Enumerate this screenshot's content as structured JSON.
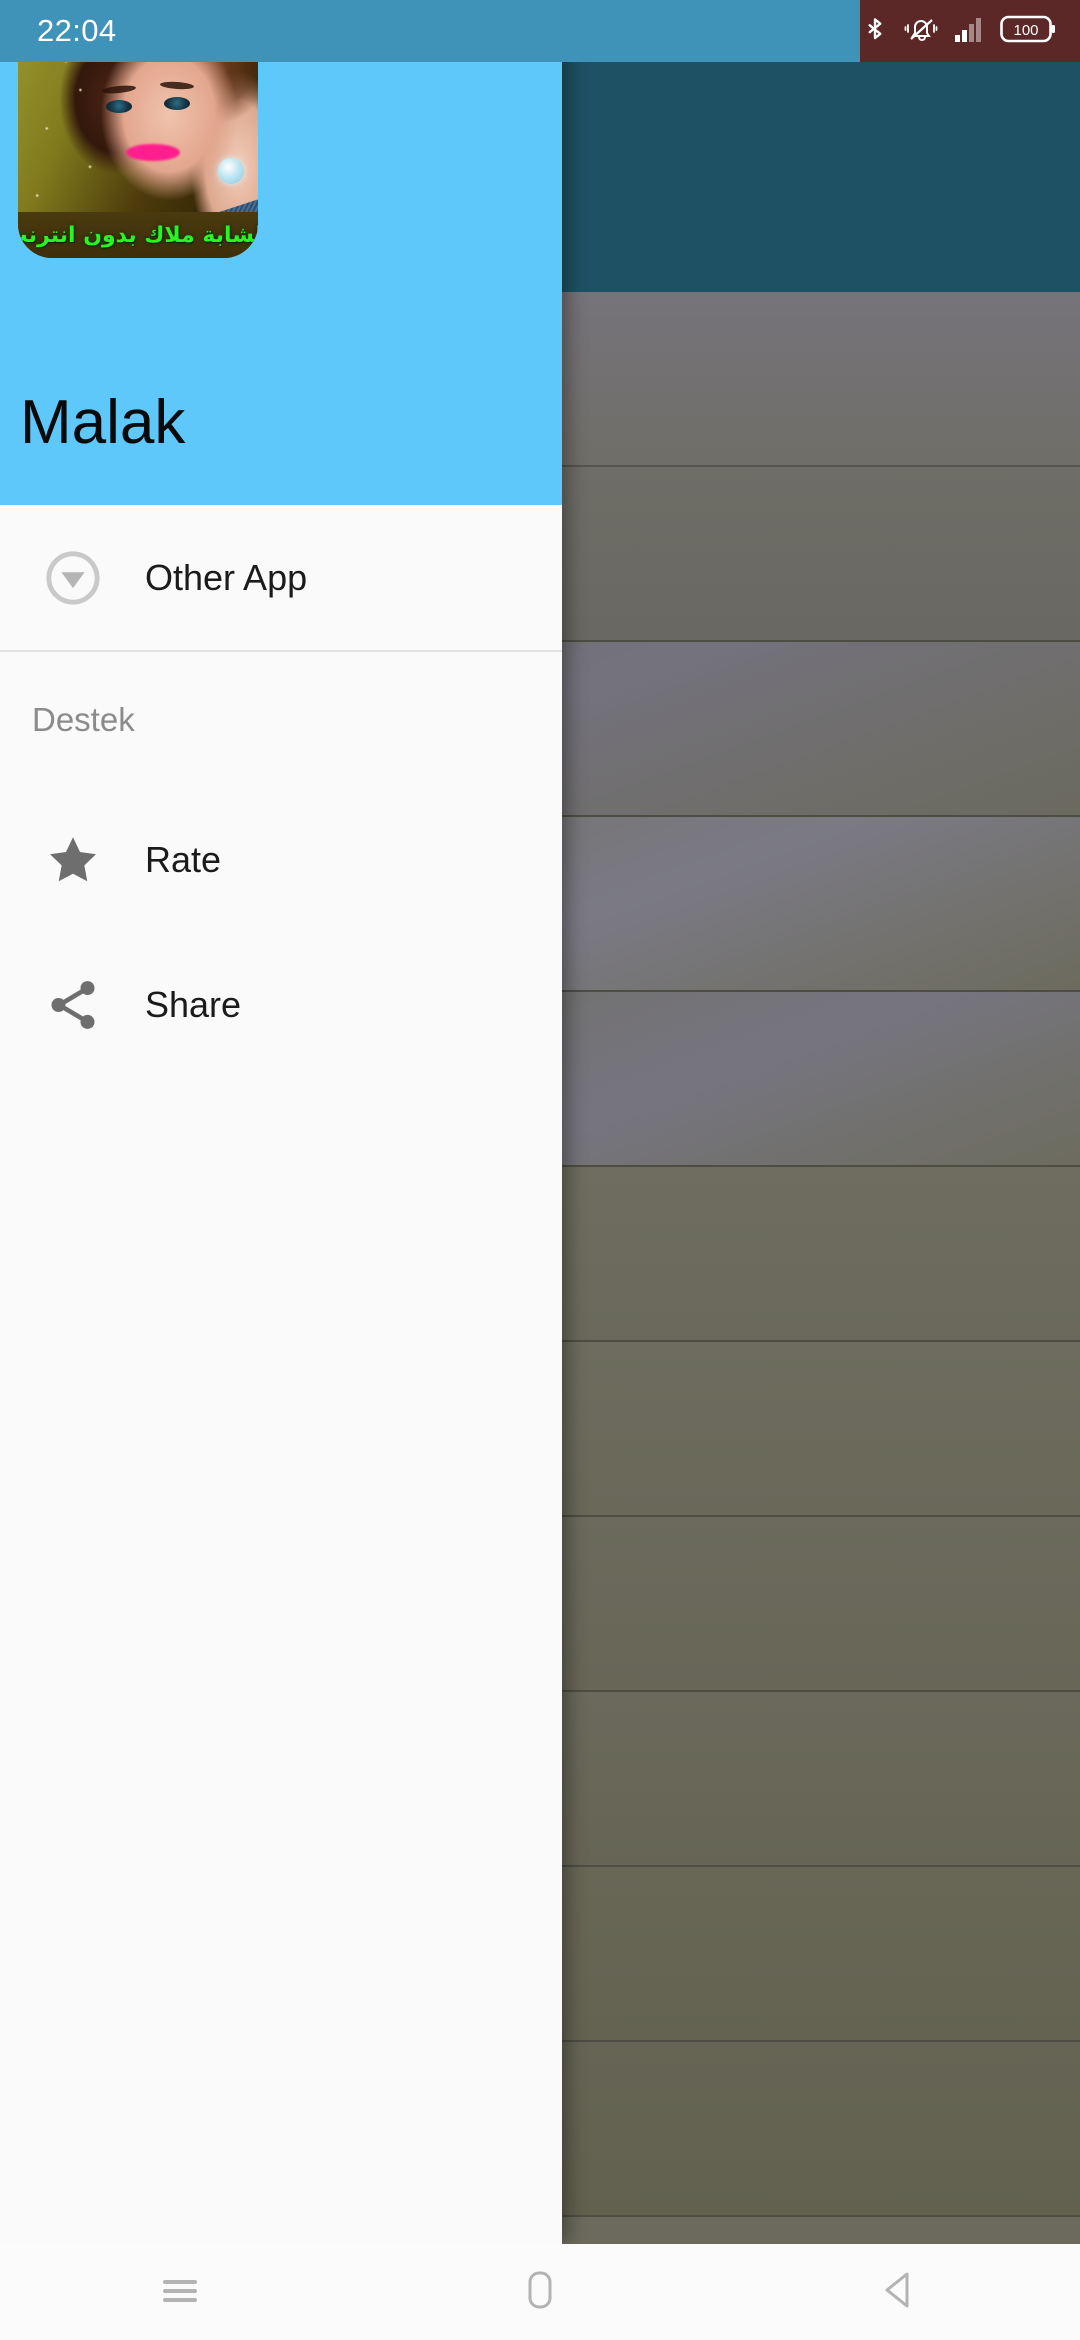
{
  "status_bar": {
    "clock": "22:04",
    "battery_level": "100",
    "icons": [
      "bluetooth-icon",
      "vibrate-mute-icon",
      "signal-bars-icon",
      "battery-icon"
    ],
    "left_background_color": "#3f92b8",
    "right_background_color": "#5c2727"
  },
  "drawer": {
    "header": {
      "app_name": "Malak",
      "icon_caption": "الشابة ملاك بدون انترنت",
      "background_color": "#5ec8fa",
      "title_color": "#0a0a0a",
      "caption_color": "#29f522"
    },
    "items": [
      {
        "id": "other-app",
        "label": "Other App",
        "icon": "download-circle-icon"
      }
    ],
    "sections": [
      {
        "id": "destek",
        "title": "Destek",
        "items": [
          {
            "id": "rate",
            "label": "Rate",
            "icon": "star-icon"
          },
          {
            "id": "share",
            "label": "Share",
            "icon": "share-icon"
          }
        ]
      }
    ],
    "background_color": "#fafafa",
    "icon_color": "#6e6e6e"
  },
  "background_app": {
    "appbar_color": "#1d5163",
    "list_row_count": 11
  },
  "navigation_bar": {
    "buttons": [
      {
        "id": "recents",
        "icon": "menu-recents-icon"
      },
      {
        "id": "home",
        "icon": "home-square-icon"
      },
      {
        "id": "back",
        "icon": "back-triangle-icon"
      }
    ],
    "background_color": "#fbfbfb",
    "icon_color": "#b3b3b3"
  }
}
